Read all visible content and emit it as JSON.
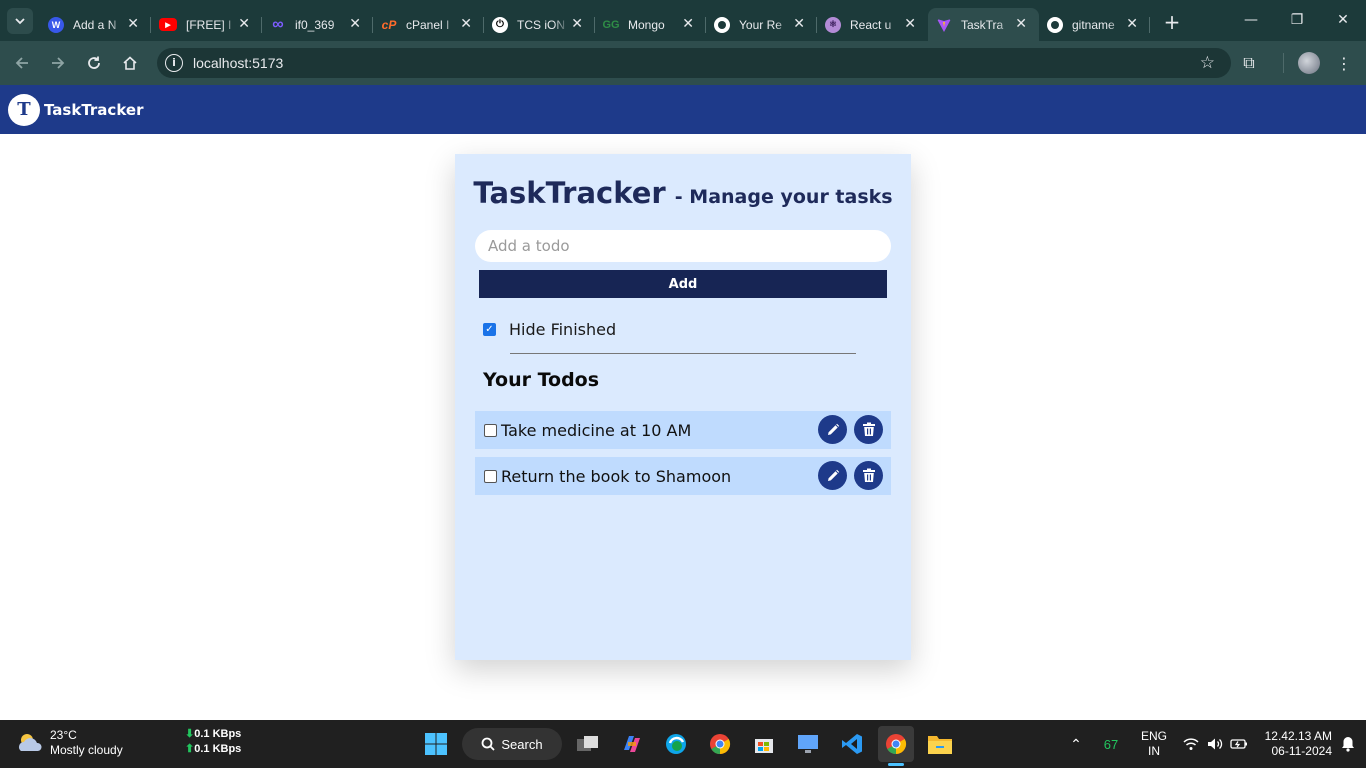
{
  "browser": {
    "tabs": [
      {
        "title": "Add a N",
        "icon": "wordpress-icon",
        "color": "#3858e9"
      },
      {
        "title": "[FREE] I",
        "icon": "youtube-icon",
        "color": "#ff0000"
      },
      {
        "title": "if0_369",
        "icon": "infinity-icon",
        "color": "#7c5cff"
      },
      {
        "title": "cPanel I",
        "icon": "cpanel-icon",
        "color": "#ff6c2c"
      },
      {
        "title": "TCS iON",
        "icon": "tcs-icon",
        "color": "#ffffff"
      },
      {
        "title": "Mongo",
        "icon": "geeksforgeeks-icon",
        "color": "#2f8d46"
      },
      {
        "title": "Your Re",
        "icon": "github-icon",
        "color": "#ffffff"
      },
      {
        "title": "React u",
        "icon": "react-icon",
        "color": "#b38bd6"
      },
      {
        "title": "TaskTra",
        "icon": "vite-icon",
        "color": "#a855f7",
        "active": true
      },
      {
        "title": "gitname",
        "icon": "github-icon",
        "color": "#ffffff"
      }
    ],
    "url": "localhost:5173"
  },
  "app": {
    "brand": "TaskTracker",
    "logo_letter": "T",
    "title": "TaskTracker",
    "subtitle": "- Manage your tasks",
    "input_placeholder": "Add a todo",
    "add_label": "Add",
    "hide_finished_label": "Hide Finished",
    "hide_finished_checked": true,
    "todos_heading": "Your Todos",
    "todos": [
      {
        "text": "Take medicine at 10 AM",
        "done": false
      },
      {
        "text": "Return the book to Shamoon",
        "done": false
      }
    ],
    "colors": {
      "nav": "#1e3a8a",
      "card": "#dbeafe",
      "item": "#bfdbfe",
      "button": "#172554"
    }
  },
  "taskbar": {
    "weather_temp": "23°C",
    "weather_desc": "Mostly cloudy",
    "net_down": "0.1 KBps",
    "net_up": "0.1 KBps",
    "search_label": "Search",
    "tray_count": "67",
    "lang_top": "ENG",
    "lang_bottom": "IN",
    "time": "12.42.13 AM",
    "date": "06-11-2024"
  }
}
